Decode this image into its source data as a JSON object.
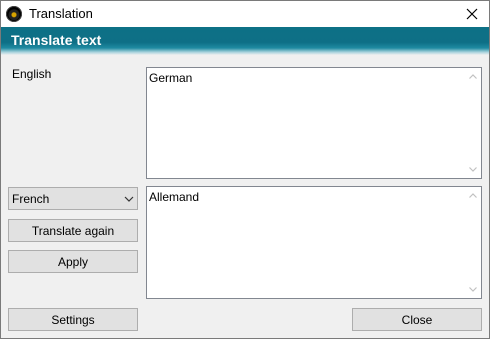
{
  "window": {
    "title": "Translation"
  },
  "header": {
    "title": "Translate text"
  },
  "source": {
    "language": "English",
    "text": "German"
  },
  "target": {
    "language": "French",
    "text": "Allemand"
  },
  "buttons": {
    "translate_again": "Translate again",
    "apply": "Apply",
    "settings": "Settings",
    "close": "Close"
  },
  "icons": [
    "app-icon",
    "close-icon",
    "chevron-down-icon",
    "scroll-up-icon",
    "scroll-down-icon"
  ],
  "colors": {
    "header": "#0e6f86",
    "button": "#e1e1e1",
    "window_bg": "#f0f0f0"
  }
}
